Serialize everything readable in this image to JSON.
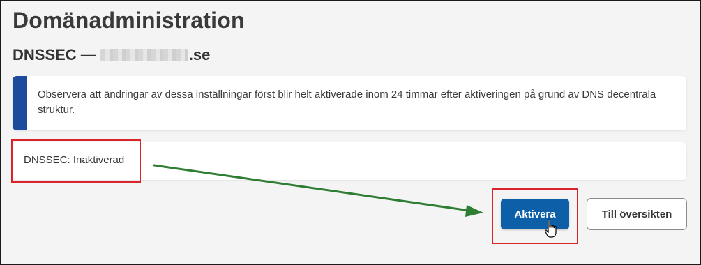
{
  "header": {
    "title": "Domänadministration",
    "subtitle_prefix": "DNSSEC —",
    "subtitle_suffix": ".se"
  },
  "notice": {
    "text": "Observera att ändringar av dessa inställningar först blir helt aktiverade inom 24 timmar efter aktiveringen på grund av DNS decentrala struktur.",
    "accent_color": "#1c4a9c"
  },
  "status": {
    "text": "DNSSEC: Inaktiverad"
  },
  "actions": {
    "activate_label": "Aktivera",
    "overview_label": "Till översikten"
  },
  "colors": {
    "primary": "#0d5fa8",
    "annotation_box": "#d9252a",
    "annotation_arrow": "#2e7d32"
  },
  "icons": {
    "cursor": "hand-pointer-icon",
    "arrow": "annotation-arrow"
  }
}
